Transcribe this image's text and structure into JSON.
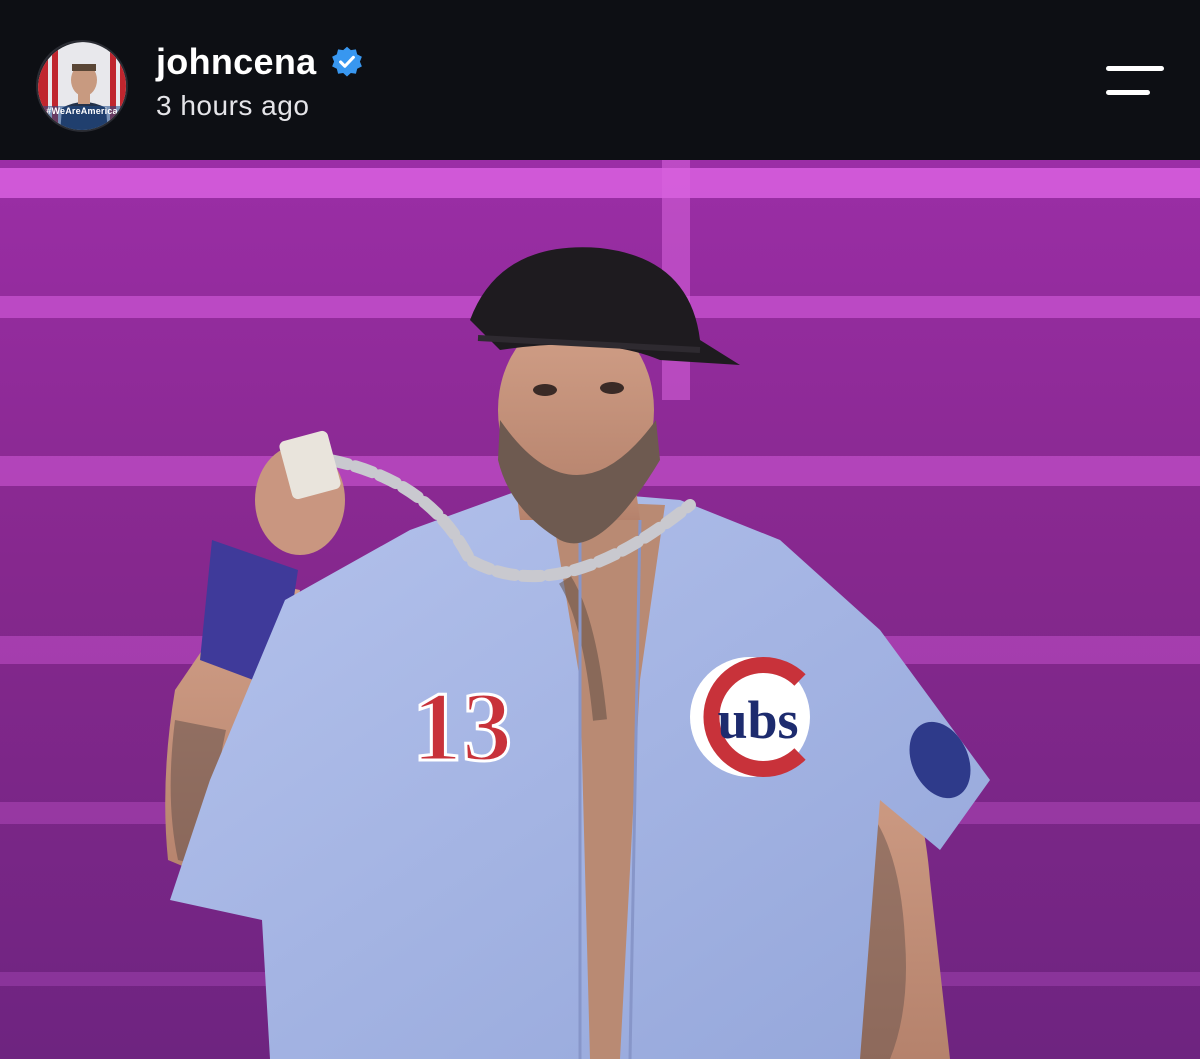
{
  "post": {
    "username": "johncena",
    "verified": true,
    "timestamp": "3 hours ago",
    "avatar_caption": "#WeAreAmerica",
    "menu_icon": "hamburger-menu-icon"
  },
  "photo": {
    "subject_jersey": {
      "number": "13",
      "logo_text": "ubs",
      "logo_letter": "C"
    }
  },
  "colors": {
    "header_background": "#0d0f14",
    "verified_badge": "#3897f0",
    "stage_background": "#8a2a8f",
    "jersey": "#a9b8e6",
    "jersey_number": "#c8323a"
  }
}
